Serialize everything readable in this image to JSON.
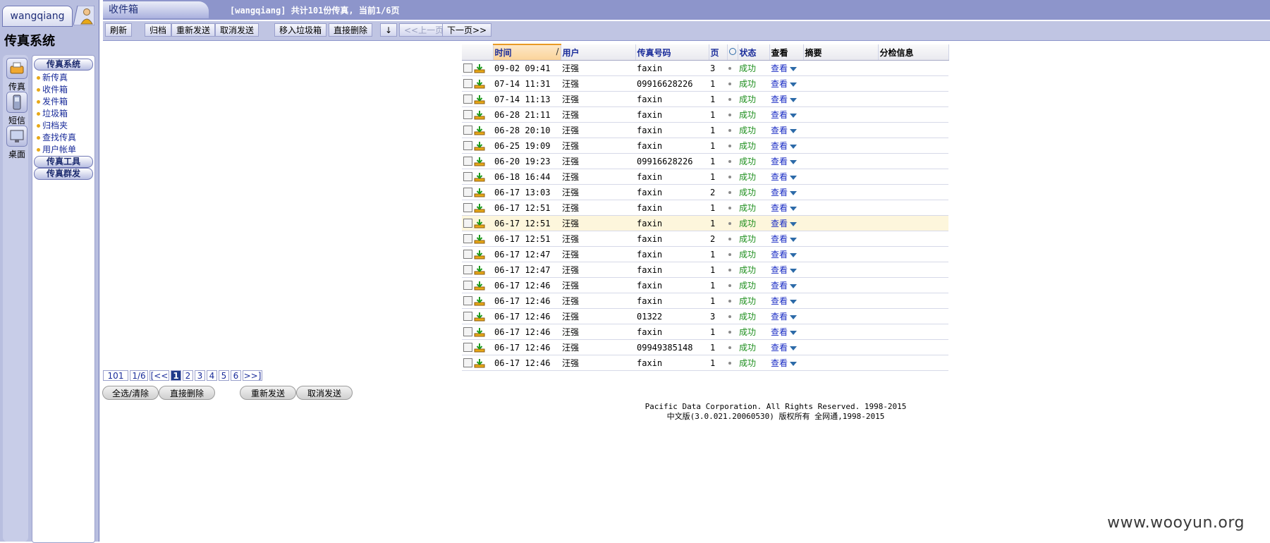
{
  "sidebar": {
    "username": "wangqiang",
    "system_title": "传真系统",
    "nav_icons": [
      {
        "label": "传真",
        "icon": "fax-icon"
      },
      {
        "label": "短信",
        "icon": "sms-phone-icon"
      },
      {
        "label": "桌面",
        "icon": "desktop-icon"
      }
    ],
    "menu_sections": {
      "fax_system": "传真系统",
      "fax_tools": "传真工具",
      "fax_broadcast": "传真群发"
    },
    "menu_items": [
      "新传真",
      "收件箱",
      "发件箱",
      "垃圾箱",
      "归档夹",
      "查找传真",
      "用户帐单"
    ]
  },
  "header": {
    "title": "收件箱",
    "info": "[wangqiang] 共计101份传真, 当前1/6页"
  },
  "toolbar": {
    "refresh": "刷新",
    "archive": "归档",
    "resend": "重新发送",
    "cancel_send": "取消发送",
    "move_trash": "移入垃圾箱",
    "delete_direct": "直接删除",
    "down_arrow": "↓",
    "prev_page": "<<上一页",
    "next_page": "下一页>>"
  },
  "table": {
    "headers": {
      "time": "时间",
      "user": "用户",
      "fax_number": "传真号码",
      "pages": "页",
      "status": "状态",
      "view": "查看",
      "summary": "摘要",
      "routing": "分检信息"
    },
    "rows": [
      {
        "time": "09-02 09:41",
        "user": "汪强",
        "number": "faxin",
        "pages": "3",
        "status": "成功",
        "view": "查看"
      },
      {
        "time": "07-14 11:31",
        "user": "汪强",
        "number": "09916628226",
        "pages": "1",
        "status": "成功",
        "view": "查看"
      },
      {
        "time": "07-14 11:13",
        "user": "汪强",
        "number": "faxin",
        "pages": "1",
        "status": "成功",
        "view": "查看"
      },
      {
        "time": "06-28 21:11",
        "user": "汪强",
        "number": "faxin",
        "pages": "1",
        "status": "成功",
        "view": "查看"
      },
      {
        "time": "06-28 20:10",
        "user": "汪强",
        "number": "faxin",
        "pages": "1",
        "status": "成功",
        "view": "查看"
      },
      {
        "time": "06-25 19:09",
        "user": "汪强",
        "number": "faxin",
        "pages": "1",
        "status": "成功",
        "view": "查看"
      },
      {
        "time": "06-20 19:23",
        "user": "汪强",
        "number": "09916628226",
        "pages": "1",
        "status": "成功",
        "view": "查看"
      },
      {
        "time": "06-18 16:44",
        "user": "汪强",
        "number": "faxin",
        "pages": "1",
        "status": "成功",
        "view": "查看"
      },
      {
        "time": "06-17 13:03",
        "user": "汪强",
        "number": "faxin",
        "pages": "2",
        "status": "成功",
        "view": "查看"
      },
      {
        "time": "06-17 12:51",
        "user": "汪强",
        "number": "faxin",
        "pages": "1",
        "status": "成功",
        "view": "查看"
      },
      {
        "time": "06-17 12:51",
        "user": "汪强",
        "number": "faxin",
        "pages": "1",
        "status": "成功",
        "view": "查看"
      },
      {
        "time": "06-17 12:51",
        "user": "汪强",
        "number": "faxin",
        "pages": "2",
        "status": "成功",
        "view": "查看"
      },
      {
        "time": "06-17 12:47",
        "user": "汪强",
        "number": "faxin",
        "pages": "1",
        "status": "成功",
        "view": "查看"
      },
      {
        "time": "06-17 12:47",
        "user": "汪强",
        "number": "faxin",
        "pages": "1",
        "status": "成功",
        "view": "查看"
      },
      {
        "time": "06-17 12:46",
        "user": "汪强",
        "number": "faxin",
        "pages": "1",
        "status": "成功",
        "view": "查看"
      },
      {
        "time": "06-17 12:46",
        "user": "汪强",
        "number": "faxin",
        "pages": "1",
        "status": "成功",
        "view": "查看"
      },
      {
        "time": "06-17 12:46",
        "user": "汪强",
        "number": "01322",
        "pages": "3",
        "status": "成功",
        "view": "查看"
      },
      {
        "time": "06-17 12:46",
        "user": "汪强",
        "number": "faxin",
        "pages": "1",
        "status": "成功",
        "view": "查看"
      },
      {
        "time": "06-17 12:46",
        "user": "汪强",
        "number": "09949385148",
        "pages": "1",
        "status": "成功",
        "view": "查看"
      },
      {
        "time": "06-17 12:46",
        "user": "汪强",
        "number": "faxin",
        "pages": "1",
        "status": "成功",
        "view": "查看"
      }
    ]
  },
  "pager": {
    "total": "101",
    "page_of": "1/6",
    "first": "[<<",
    "pages": [
      "1",
      "2",
      "3",
      "4",
      "5",
      "6"
    ],
    "current_page": "1",
    "last": ">>]"
  },
  "bottom_buttons": {
    "select_all": "全选/清除",
    "delete_direct": "直接删除",
    "resend": "重新发送",
    "cancel_send": "取消发送"
  },
  "footer": {
    "line1": "Pacific Data Corporation. All Rights Reserved. 1998-2015",
    "line2": "中文版(3.0.021.20060530) 版权所有 全网通,1998-2015"
  },
  "watermark": "www.wooyun.org",
  "colors": {
    "sidebar_bg": "#b8bedf",
    "titlebar_bg": "#8d95cb",
    "toolbar_bg": "#c0c5e3",
    "status_ok": "#1e8f1e",
    "link": "#1a2cc4",
    "highlight_row": "#fdf6dc"
  }
}
